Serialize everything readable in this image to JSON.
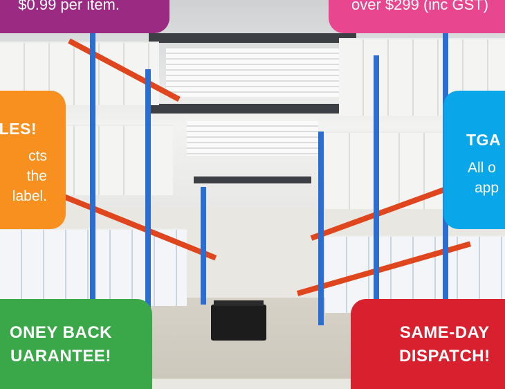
{
  "badges": {
    "price": {
      "text": "$0.99 per item.",
      "color": "#9b2a83"
    },
    "shipping": {
      "text": "over $299 (inc GST)",
      "color": "#e8478f"
    },
    "sales": {
      "title": "LES!",
      "lines": [
        "cts",
        "the",
        "label."
      ],
      "color": "#f7901e"
    },
    "tga": {
      "title": "TGA",
      "lines": [
        "All o",
        "app"
      ],
      "color": "#0aa6ea"
    },
    "money_back": {
      "lines": [
        "ONEY BACK",
        "UARANTEE!"
      ],
      "color": "#3aa848"
    },
    "dispatch": {
      "lines": [
        "SAME-DAY",
        "DISPATCH!"
      ],
      "color": "#d8202e"
    }
  },
  "scene": {
    "name": "warehouse-aisle-photo"
  }
}
